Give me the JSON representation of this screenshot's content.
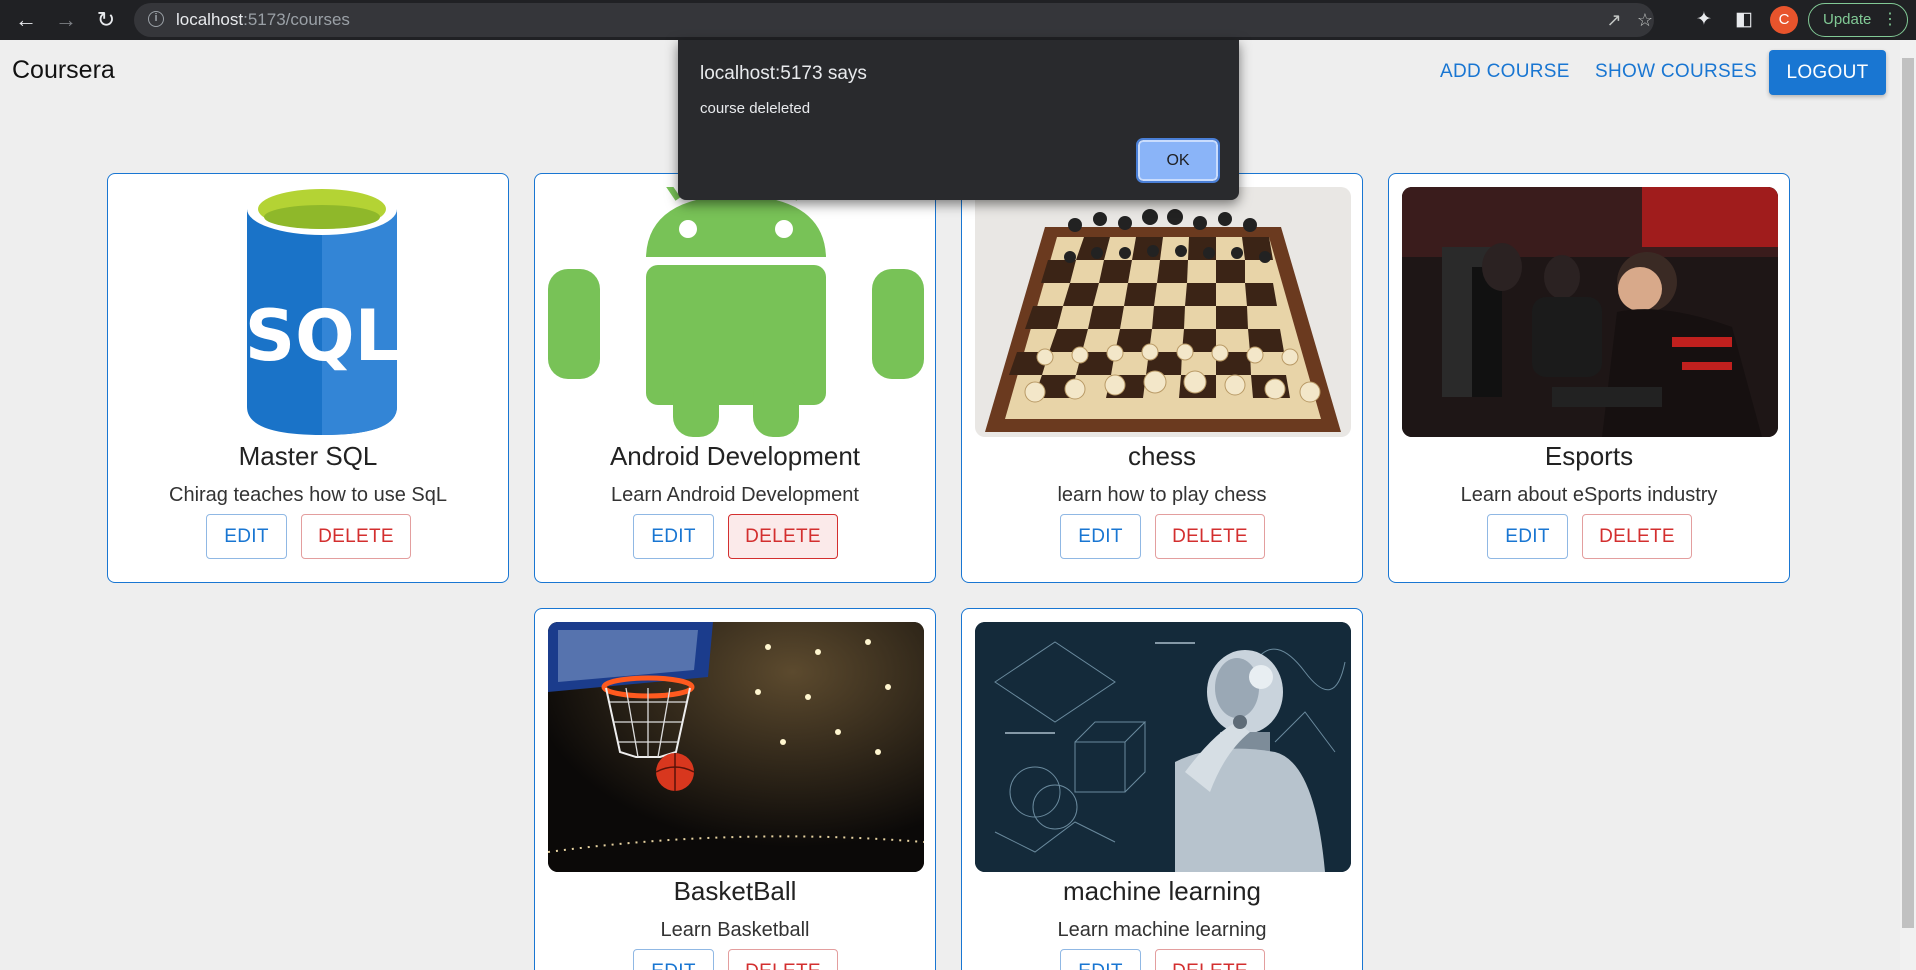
{
  "browser": {
    "url_host": "localhost",
    "url_path": ":5173/courses",
    "avatar_letter": "C",
    "update_label": "Update",
    "icons": [
      "back-icon",
      "forward-icon",
      "reload-icon",
      "site-info-icon",
      "share-icon",
      "bookmark-star-icon",
      "extensions-icon",
      "side-panel-icon",
      "more-icon"
    ]
  },
  "appbar": {
    "brand": "Coursera",
    "add_course": "ADD COURSE",
    "show_courses": "SHOW COURSES",
    "logout": "LOGOUT"
  },
  "courses": [
    {
      "title": "Master SQL",
      "description": "Chirag teaches how to use SqL",
      "image": "sql-database-logo",
      "image_text": "SQL",
      "edit": "EDIT",
      "delete": "DELETE"
    },
    {
      "title": "Android Development",
      "description": "Learn Android Development",
      "image": "android-robot-logo",
      "edit": "EDIT",
      "delete": "DELETE"
    },
    {
      "title": "chess",
      "description": "learn how to play chess",
      "image": "chess-board-photo",
      "edit": "EDIT",
      "delete": "DELETE"
    },
    {
      "title": "Esports",
      "description": "Learn about eSports industry",
      "image": "esports-players-photo",
      "edit": "EDIT",
      "delete": "DELETE"
    },
    {
      "title": "BasketBall",
      "description": "Learn Basketball",
      "image": "basketball-hoop-photo",
      "edit": "EDIT",
      "delete": "DELETE"
    },
    {
      "title": "machine learning",
      "description": "Learn machine learning",
      "image": "robot-thinking-photo",
      "edit": "EDIT",
      "delete": "DELETE"
    }
  ],
  "alert": {
    "title": "localhost:5173 says",
    "message": "course deleleted",
    "ok": "OK"
  },
  "colors": {
    "primary": "#1976d2",
    "danger": "#d32f2f",
    "background": "#eeeeee",
    "chrome": "#202124",
    "dialog": "#292a2d"
  }
}
